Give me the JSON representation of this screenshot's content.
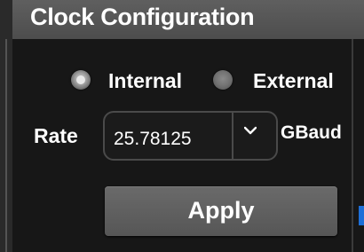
{
  "panel": {
    "title": "Clock Configuration"
  },
  "clock_source": {
    "options": [
      {
        "label": "Internal",
        "selected": true
      },
      {
        "label": "External",
        "selected": false
      }
    ]
  },
  "rate": {
    "label": "Rate",
    "value": "25.78125",
    "unit": "GBaud"
  },
  "apply": {
    "label": "Apply"
  },
  "colors": {
    "background": "#171717",
    "header": "#555555",
    "button": "#606060",
    "text": "#ffffff",
    "edge_accent": "#1e6fd8"
  }
}
